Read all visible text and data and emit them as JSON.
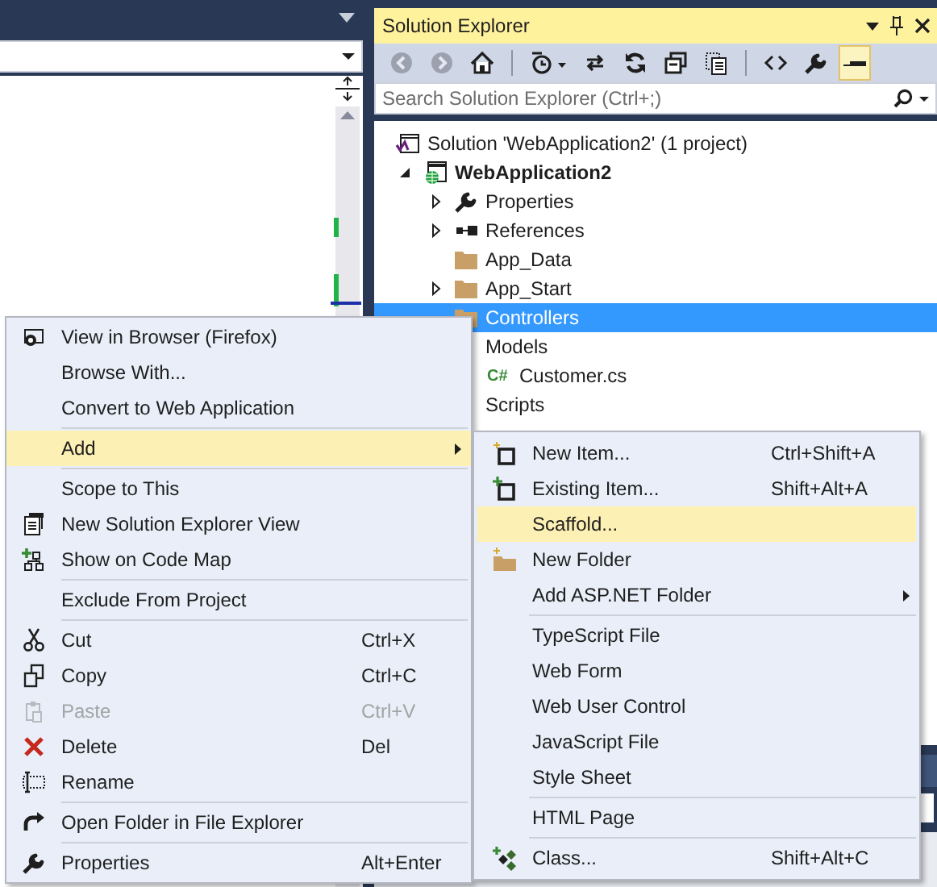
{
  "solution_explorer": {
    "title": "Solution Explorer",
    "toolbar": [
      {
        "kind": "button",
        "disabled": true,
        "selected": false
      },
      {
        "kind": "button",
        "disabled": true,
        "selected": false
      },
      {
        "kind": "button",
        "disabled": false,
        "selected": false
      },
      {
        "kind": "separator"
      },
      {
        "kind": "button",
        "disabled": false,
        "selected": false
      },
      {
        "kind": "button",
        "disabled": false,
        "selected": false
      },
      {
        "kind": "button",
        "disabled": false,
        "selected": false
      },
      {
        "kind": "button",
        "disabled": false,
        "selected": false
      },
      {
        "kind": "button",
        "disabled": false,
        "selected": false
      },
      {
        "kind": "separator"
      },
      {
        "kind": "button",
        "disabled": false,
        "selected": false
      },
      {
        "kind": "button",
        "disabled": false,
        "selected": false
      },
      {
        "kind": "button",
        "disabled": false,
        "selected": true
      }
    ],
    "search": {
      "placeholder": "Search Solution Explorer (Ctrl+;)"
    },
    "tree": [
      {
        "label": "Solution 'WebApplication2' (1 project)",
        "kind": "solution",
        "selected": false,
        "children": [
          {
            "label": "WebApplication2",
            "kind": "project",
            "selected": false,
            "expanded": true,
            "children": [
              {
                "label": "Properties",
                "kind": "properties",
                "selected": false,
                "expanded": false
              },
              {
                "label": "References",
                "kind": "references",
                "selected": false,
                "expanded": false
              },
              {
                "label": "App_Data",
                "kind": "folder",
                "selected": false
              },
              {
                "label": "App_Start",
                "kind": "folder",
                "selected": false,
                "expanded": false
              },
              {
                "label": "Controllers",
                "kind": "folder",
                "selected": true
              },
              {
                "label": "Models",
                "kind": "covered",
                "selected": false,
                "children": [
                  {
                    "label": "Customer.cs",
                    "kind": "file",
                    "icon_text": "C#",
                    "selected": false
                  }
                ]
              },
              {
                "label": "Scripts",
                "kind": "covered",
                "selected": false
              }
            ]
          }
        ]
      }
    ]
  },
  "context_menu": {
    "items": [
      {
        "kind": "item",
        "label": "View in Browser (Firefox)",
        "selected": false,
        "disabled": false,
        "submenu": false
      },
      {
        "kind": "item",
        "label": "Browse With...",
        "selected": false,
        "disabled": false,
        "submenu": false
      },
      {
        "kind": "item",
        "label": "Convert to Web Application",
        "selected": false,
        "disabled": false,
        "submenu": false
      },
      {
        "kind": "separator"
      },
      {
        "kind": "item",
        "label": "Add",
        "selected": true,
        "disabled": false,
        "submenu": true
      },
      {
        "kind": "separator"
      },
      {
        "kind": "item",
        "label": "Scope to This",
        "selected": false,
        "disabled": false,
        "submenu": false
      },
      {
        "kind": "item",
        "label": "New Solution Explorer View",
        "selected": false,
        "disabled": false,
        "submenu": false
      },
      {
        "kind": "item",
        "label": "Show on Code Map",
        "selected": false,
        "disabled": false,
        "submenu": false
      },
      {
        "kind": "separator"
      },
      {
        "kind": "item",
        "label": "Exclude From Project",
        "selected": false,
        "disabled": false,
        "submenu": false
      },
      {
        "kind": "separator"
      },
      {
        "kind": "item",
        "label": "Cut",
        "shortcut": "Ctrl+X",
        "selected": false,
        "disabled": false,
        "submenu": false
      },
      {
        "kind": "item",
        "label": "Copy",
        "shortcut": "Ctrl+C",
        "selected": false,
        "disabled": false,
        "submenu": false
      },
      {
        "kind": "item",
        "label": "Paste",
        "shortcut": "Ctrl+V",
        "selected": false,
        "disabled": true,
        "submenu": false
      },
      {
        "kind": "item",
        "label": "Delete",
        "shortcut": "Del",
        "selected": false,
        "disabled": false,
        "submenu": false
      },
      {
        "kind": "item",
        "label": "Rename",
        "selected": false,
        "disabled": false,
        "submenu": false
      },
      {
        "kind": "separator"
      },
      {
        "kind": "item",
        "label": "Open Folder in File Explorer",
        "selected": false,
        "disabled": false,
        "submenu": false
      },
      {
        "kind": "separator"
      },
      {
        "kind": "item",
        "label": "Properties",
        "shortcut": "Alt+Enter",
        "selected": false,
        "disabled": false,
        "submenu": false
      }
    ]
  },
  "add_submenu": {
    "items": [
      {
        "kind": "item",
        "label": "New Item...",
        "shortcut": "Ctrl+Shift+A",
        "selected": false,
        "disabled": false,
        "submenu": false
      },
      {
        "kind": "item",
        "label": "Existing Item...",
        "shortcut": "Shift+Alt+A",
        "selected": false,
        "disabled": false,
        "submenu": false
      },
      {
        "kind": "item",
        "label": "Scaffold...",
        "selected": true,
        "disabled": false,
        "submenu": false
      },
      {
        "kind": "item",
        "label": "New Folder",
        "selected": false,
        "disabled": false,
        "submenu": false
      },
      {
        "kind": "item",
        "label": "Add ASP.NET Folder",
        "selected": false,
        "disabled": false,
        "submenu": true
      },
      {
        "kind": "separator"
      },
      {
        "kind": "item",
        "label": "TypeScript File",
        "selected": false,
        "disabled": false,
        "submenu": false
      },
      {
        "kind": "item",
        "label": "Web Form",
        "selected": false,
        "disabled": false,
        "submenu": false
      },
      {
        "kind": "item",
        "label": "Web User Control",
        "selected": false,
        "disabled": false,
        "submenu": false
      },
      {
        "kind": "item",
        "label": "JavaScript File",
        "selected": false,
        "disabled": false,
        "submenu": false
      },
      {
        "kind": "item",
        "label": "Style Sheet",
        "selected": false,
        "disabled": false,
        "submenu": false
      },
      {
        "kind": "separator"
      },
      {
        "kind": "item",
        "label": "HTML Page",
        "selected": false,
        "disabled": false,
        "submenu": false
      },
      {
        "kind": "separator"
      },
      {
        "kind": "item",
        "label": "Class...",
        "shortcut": "Shift+Alt+C",
        "selected": false,
        "disabled": false,
        "submenu": false
      }
    ]
  }
}
